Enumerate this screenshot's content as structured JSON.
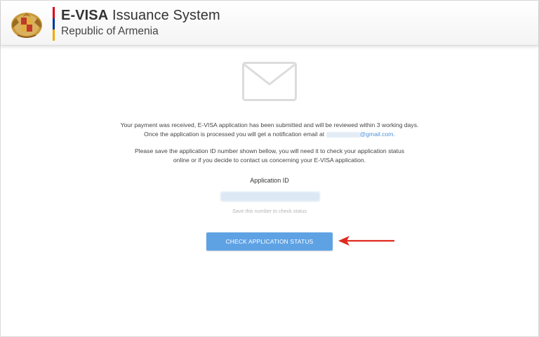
{
  "header": {
    "title_bold": "E-VISA",
    "title_rest": " Issuance System",
    "subtitle": "Republic of Armenia",
    "flag_colors": [
      "#d90012",
      "#0033a0",
      "#f2a800"
    ],
    "logo_icon": "armenia-coat-of-arms-icon"
  },
  "main": {
    "envelope_icon": "envelope-icon",
    "message_line1": "Your payment was received, E-VISA application has been submitted and will be reviewed within 3 working days.",
    "message_line2_prefix": "Once the application is processed you will get a notification email at",
    "email_suffix": "@gmail.com.",
    "save_line1": "Please save the application ID number shown bellow, you will need it to check your application status",
    "save_line2": "online or if you decide to contact us concerning your E-VISA application.",
    "app_id_label": "Application ID",
    "save_note": "Save this number to check status",
    "check_button": "CHECK APPLICATION STATUS",
    "button_color": "#5fa2e4",
    "arrow_color": "#e02a1f"
  }
}
